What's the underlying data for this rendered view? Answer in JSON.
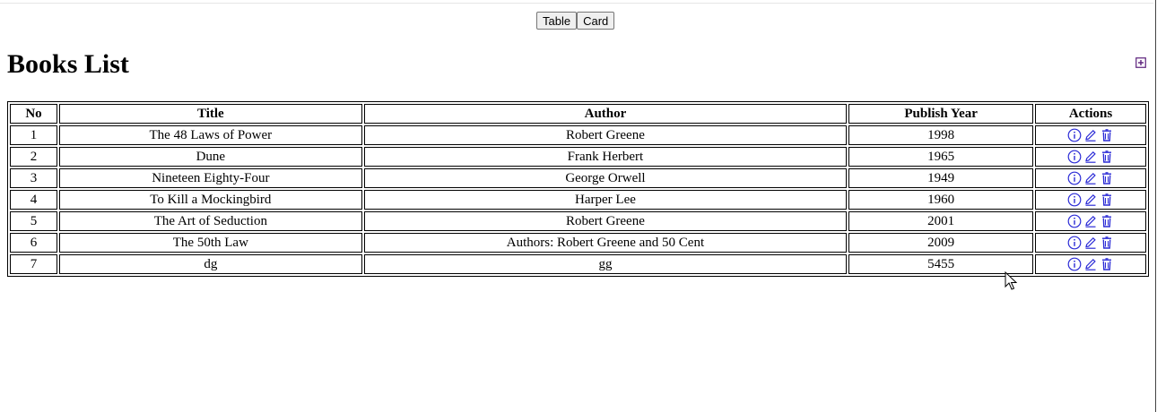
{
  "view_toggle": {
    "table_label": "Table",
    "card_label": "Card"
  },
  "page_title": "Books List",
  "table": {
    "headers": {
      "no": "No",
      "title": "Title",
      "author": "Author",
      "year": "Publish Year",
      "actions": "Actions"
    },
    "rows": [
      {
        "no": "1",
        "title": "The 48 Laws of Power",
        "author": "Robert Greene",
        "year": "1998"
      },
      {
        "no": "2",
        "title": "Dune",
        "author": "Frank Herbert",
        "year": "1965"
      },
      {
        "no": "3",
        "title": "Nineteen Eighty-Four",
        "author": "George Orwell",
        "year": "1949"
      },
      {
        "no": "4",
        "title": "To Kill a Mockingbird",
        "author": "Harper Lee",
        "year": "1960"
      },
      {
        "no": "5",
        "title": "The Art of Seduction",
        "author": "Robert Greene",
        "year": "2001"
      },
      {
        "no": "6",
        "title": "The 50th Law",
        "author": "Authors: Robert Greene and 50 Cent",
        "year": "2009"
      },
      {
        "no": "7",
        "title": "dg",
        "author": "gg",
        "year": "5455"
      }
    ]
  },
  "icons": {
    "add": "add-box-icon",
    "info": "info-circle-icon",
    "edit": "pencil-icon",
    "delete": "trash-icon"
  },
  "colors": {
    "action_icon": "#2b2bd6",
    "add_icon": "#5a1f7a"
  }
}
